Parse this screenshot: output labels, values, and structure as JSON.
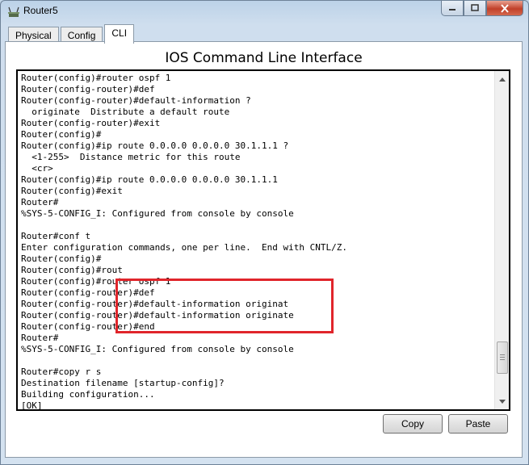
{
  "window": {
    "title": "Router5"
  },
  "tabs": [
    {
      "label": "Physical"
    },
    {
      "label": "Config"
    },
    {
      "label": "CLI"
    }
  ],
  "heading": "IOS Command Line Interface",
  "console": {
    "lines": [
      "Router(config)#router ospf 1",
      "Router(config-router)#def",
      "Router(config-router)#default-information ?",
      "  originate  Distribute a default route",
      "Router(config-router)#exit",
      "Router(config)#",
      "Router(config)#ip route 0.0.0.0 0.0.0.0 30.1.1.1 ?",
      "  <1-255>  Distance metric for this route",
      "  <cr>",
      "Router(config)#ip route 0.0.0.0 0.0.0.0 30.1.1.1",
      "Router(config)#exit",
      "Router#",
      "%SYS-5-CONFIG_I: Configured from console by console",
      "",
      "Router#conf t",
      "Enter configuration commands, one per line.  End with CNTL/Z.",
      "Router(config)#",
      "Router(config)#rout",
      "Router(config)#router ospf 1",
      "Router(config-router)#def",
      "Router(config-router)#default-information originat",
      "Router(config-router)#default-information originate",
      "Router(config-router)#end",
      "Router#",
      "%SYS-5-CONFIG_I: Configured from console by console",
      "",
      "Router#copy r s",
      "Destination filename [startup-config]?",
      "Building configuration...",
      "[OK]"
    ]
  },
  "buttons": {
    "copy": "Copy",
    "paste": "Paste"
  },
  "colors": {
    "highlight": "#e0252b"
  },
  "icons": {
    "app": "router-icon",
    "minimize": "minimize-icon",
    "maximize": "maximize-icon",
    "close": "close-icon",
    "scroll_up": "arrow-up-icon",
    "scroll_down": "arrow-down-icon"
  }
}
